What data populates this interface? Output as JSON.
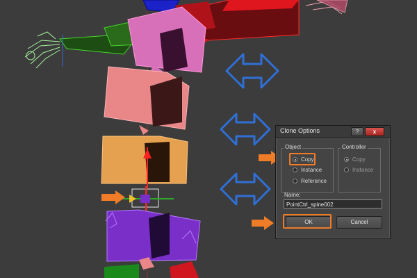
{
  "dialog": {
    "title": "Clone Options",
    "help_label": "?",
    "close_label": "x",
    "object_group": {
      "label": "Object",
      "options": [
        "Copy",
        "Instance",
        "Reference"
      ],
      "selected": "Copy"
    },
    "controller_group": {
      "label": "Controller",
      "options": [
        "Copy",
        "Instance"
      ],
      "selected": "Copy"
    },
    "name_label": "Name:",
    "name_value": "PointCtrl_spine002",
    "ok_label": "OK",
    "cancel_label": "Cancel"
  },
  "colors": {
    "viewport_bg": "#3c3c3c",
    "annotation_orange": "#f07c28",
    "annotation_blue": "#2f6fd6",
    "bone_pink": "#d86fb9",
    "bone_red": "#d0171f",
    "bone_salmon": "#e98688",
    "bone_orange": "#e5a14f",
    "bone_purple": "#7a2fc9",
    "bone_green": "#3c9a2b"
  },
  "icons": [
    "double-arrow-icon",
    "pointer-arrow-icon"
  ]
}
